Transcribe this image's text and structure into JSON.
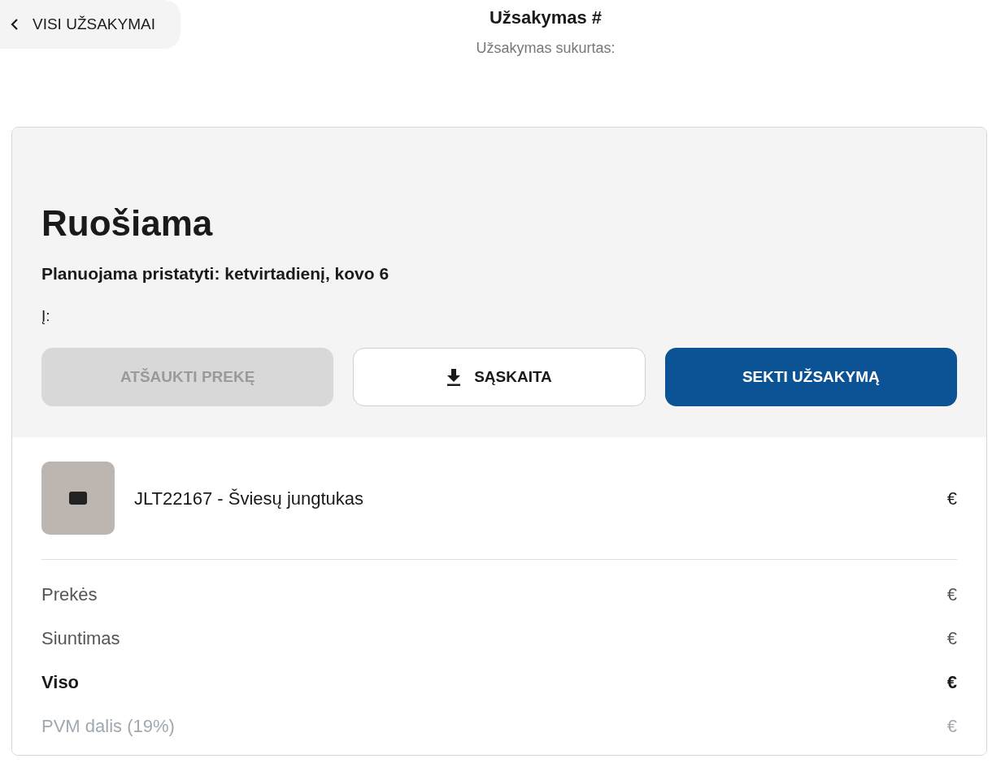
{
  "back_button": {
    "label": "VISI UŽSAKYMAI"
  },
  "header": {
    "title": "Užsakymas #",
    "subtitle": "Užsakymas sukurtas:"
  },
  "status": {
    "title": "Ruošiama",
    "delivery": "Planuojama pristatyti: ketvirtadienį, kovo 6",
    "address_label": "Į:"
  },
  "actions": [
    {
      "kind": "disabled",
      "label": "ATŠAUKTI PREKĘ"
    },
    {
      "kind": "outline",
      "label": "SĄSKAITA"
    },
    {
      "kind": "primary",
      "label": "SEKTI UŽSAKYMĄ"
    }
  ],
  "items": [
    {
      "name": "JLT22167 - Šviesų jungtukas",
      "price": "€"
    }
  ],
  "summary": [
    {
      "kind": "normal",
      "label": "Prekės",
      "value": "€"
    },
    {
      "kind": "normal",
      "label": "Siuntimas",
      "value": "€"
    },
    {
      "kind": "total",
      "label": "Viso",
      "value": "€"
    },
    {
      "kind": "muted",
      "label": "PVM dalis (19%)",
      "value": "€"
    }
  ]
}
